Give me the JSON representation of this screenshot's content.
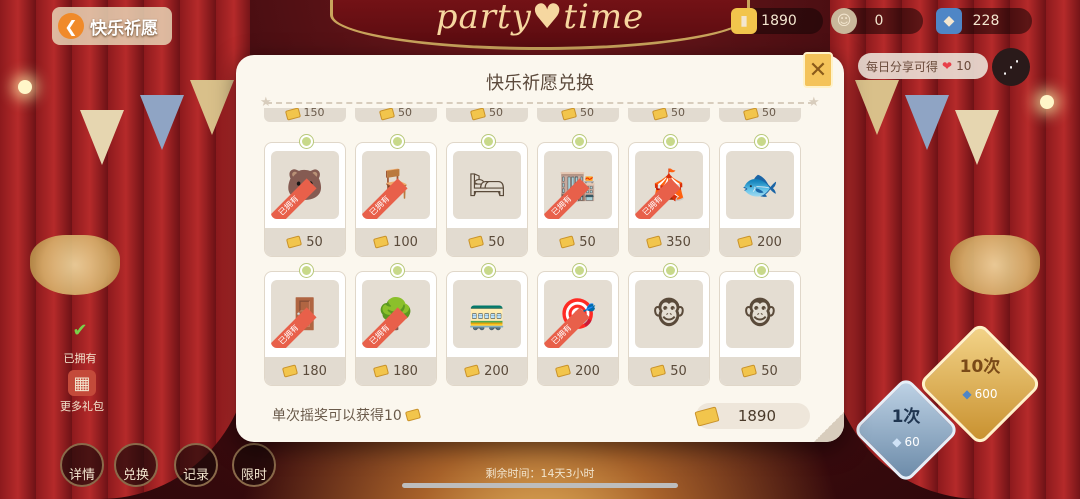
{
  "header": {
    "back_label": "快乐祈愿",
    "currencies": [
      {
        "icon": "ticket-icon",
        "value": "1890"
      },
      {
        "icon": "coin-icon",
        "value": "0"
      },
      {
        "icon": "gem-icon",
        "value": "228"
      }
    ],
    "share_text": "每日分享可得",
    "share_reward": "10"
  },
  "banner": {
    "text": "party♥time"
  },
  "modal": {
    "title": "快乐祈愿兑换",
    "partial_prices": [
      "150",
      "50",
      "50",
      "50",
      "50",
      "50"
    ],
    "items": [
      {
        "price": "50",
        "owned": true,
        "badge": "已拥有"
      },
      {
        "price": "100",
        "owned": true,
        "badge": "已拥有"
      },
      {
        "price": "50",
        "owned": false,
        "badge": ""
      },
      {
        "price": "50",
        "owned": true,
        "badge": "已拥有"
      },
      {
        "price": "350",
        "owned": true,
        "badge": "已拥有"
      },
      {
        "price": "200",
        "owned": false,
        "badge": ""
      },
      {
        "price": "180",
        "owned": true,
        "badge": "已拥有"
      },
      {
        "price": "180",
        "owned": true,
        "badge": "已拥有"
      },
      {
        "price": "200",
        "owned": false,
        "badge": ""
      },
      {
        "price": "200",
        "owned": true,
        "badge": "已拥有"
      },
      {
        "price": "50",
        "owned": false,
        "badge": ""
      },
      {
        "price": "50",
        "owned": false,
        "badge": ""
      }
    ],
    "footer_note": "单次摇奖可以获得10",
    "balance": "1890"
  },
  "side": {
    "owned_label": "已拥有",
    "gift_label": "更多礼包"
  },
  "bottom_buttons": [
    "详情",
    "兑换",
    "记录",
    "限时"
  ],
  "draw": {
    "ten_label": "10次",
    "ten_cost": "600",
    "one_label": "1次",
    "one_cost": "60"
  },
  "timer": "剩余时间：14天3小时",
  "colors": {
    "accent_gold": "#f4c35a",
    "owned_badge": "#e8604a",
    "modal_bg": "#fbf7ee",
    "indicator_dot": "#c8d98a"
  }
}
